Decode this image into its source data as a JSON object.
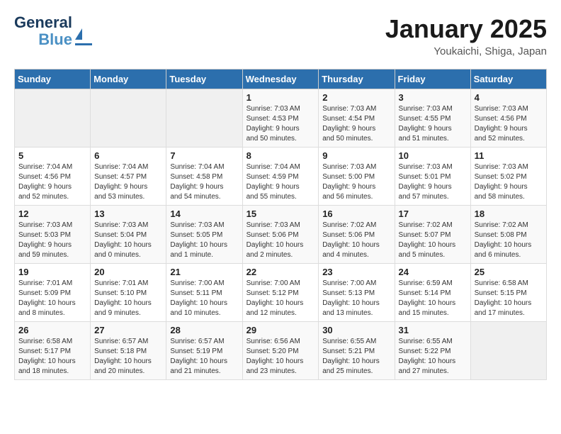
{
  "header": {
    "logo": {
      "part1": "General",
      "part2": "Blue"
    },
    "title": "January 2025",
    "location": "Youkaichi, Shiga, Japan"
  },
  "weekdays": [
    "Sunday",
    "Monday",
    "Tuesday",
    "Wednesday",
    "Thursday",
    "Friday",
    "Saturday"
  ],
  "weeks": [
    [
      {
        "day": "",
        "info": ""
      },
      {
        "day": "",
        "info": ""
      },
      {
        "day": "",
        "info": ""
      },
      {
        "day": "1",
        "info": "Sunrise: 7:03 AM\nSunset: 4:53 PM\nDaylight: 9 hours\nand 50 minutes."
      },
      {
        "day": "2",
        "info": "Sunrise: 7:03 AM\nSunset: 4:54 PM\nDaylight: 9 hours\nand 50 minutes."
      },
      {
        "day": "3",
        "info": "Sunrise: 7:03 AM\nSunset: 4:55 PM\nDaylight: 9 hours\nand 51 minutes."
      },
      {
        "day": "4",
        "info": "Sunrise: 7:03 AM\nSunset: 4:56 PM\nDaylight: 9 hours\nand 52 minutes."
      }
    ],
    [
      {
        "day": "5",
        "info": "Sunrise: 7:04 AM\nSunset: 4:56 PM\nDaylight: 9 hours\nand 52 minutes."
      },
      {
        "day": "6",
        "info": "Sunrise: 7:04 AM\nSunset: 4:57 PM\nDaylight: 9 hours\nand 53 minutes."
      },
      {
        "day": "7",
        "info": "Sunrise: 7:04 AM\nSunset: 4:58 PM\nDaylight: 9 hours\nand 54 minutes."
      },
      {
        "day": "8",
        "info": "Sunrise: 7:04 AM\nSunset: 4:59 PM\nDaylight: 9 hours\nand 55 minutes."
      },
      {
        "day": "9",
        "info": "Sunrise: 7:03 AM\nSunset: 5:00 PM\nDaylight: 9 hours\nand 56 minutes."
      },
      {
        "day": "10",
        "info": "Sunrise: 7:03 AM\nSunset: 5:01 PM\nDaylight: 9 hours\nand 57 minutes."
      },
      {
        "day": "11",
        "info": "Sunrise: 7:03 AM\nSunset: 5:02 PM\nDaylight: 9 hours\nand 58 minutes."
      }
    ],
    [
      {
        "day": "12",
        "info": "Sunrise: 7:03 AM\nSunset: 5:03 PM\nDaylight: 9 hours\nand 59 minutes."
      },
      {
        "day": "13",
        "info": "Sunrise: 7:03 AM\nSunset: 5:04 PM\nDaylight: 10 hours\nand 0 minutes."
      },
      {
        "day": "14",
        "info": "Sunrise: 7:03 AM\nSunset: 5:05 PM\nDaylight: 10 hours\nand 1 minute."
      },
      {
        "day": "15",
        "info": "Sunrise: 7:03 AM\nSunset: 5:06 PM\nDaylight: 10 hours\nand 2 minutes."
      },
      {
        "day": "16",
        "info": "Sunrise: 7:02 AM\nSunset: 5:06 PM\nDaylight: 10 hours\nand 4 minutes."
      },
      {
        "day": "17",
        "info": "Sunrise: 7:02 AM\nSunset: 5:07 PM\nDaylight: 10 hours\nand 5 minutes."
      },
      {
        "day": "18",
        "info": "Sunrise: 7:02 AM\nSunset: 5:08 PM\nDaylight: 10 hours\nand 6 minutes."
      }
    ],
    [
      {
        "day": "19",
        "info": "Sunrise: 7:01 AM\nSunset: 5:09 PM\nDaylight: 10 hours\nand 8 minutes."
      },
      {
        "day": "20",
        "info": "Sunrise: 7:01 AM\nSunset: 5:10 PM\nDaylight: 10 hours\nand 9 minutes."
      },
      {
        "day": "21",
        "info": "Sunrise: 7:00 AM\nSunset: 5:11 PM\nDaylight: 10 hours\nand 10 minutes."
      },
      {
        "day": "22",
        "info": "Sunrise: 7:00 AM\nSunset: 5:12 PM\nDaylight: 10 hours\nand 12 minutes."
      },
      {
        "day": "23",
        "info": "Sunrise: 7:00 AM\nSunset: 5:13 PM\nDaylight: 10 hours\nand 13 minutes."
      },
      {
        "day": "24",
        "info": "Sunrise: 6:59 AM\nSunset: 5:14 PM\nDaylight: 10 hours\nand 15 minutes."
      },
      {
        "day": "25",
        "info": "Sunrise: 6:58 AM\nSunset: 5:15 PM\nDaylight: 10 hours\nand 17 minutes."
      }
    ],
    [
      {
        "day": "26",
        "info": "Sunrise: 6:58 AM\nSunset: 5:17 PM\nDaylight: 10 hours\nand 18 minutes."
      },
      {
        "day": "27",
        "info": "Sunrise: 6:57 AM\nSunset: 5:18 PM\nDaylight: 10 hours\nand 20 minutes."
      },
      {
        "day": "28",
        "info": "Sunrise: 6:57 AM\nSunset: 5:19 PM\nDaylight: 10 hours\nand 21 minutes."
      },
      {
        "day": "29",
        "info": "Sunrise: 6:56 AM\nSunset: 5:20 PM\nDaylight: 10 hours\nand 23 minutes."
      },
      {
        "day": "30",
        "info": "Sunrise: 6:55 AM\nSunset: 5:21 PM\nDaylight: 10 hours\nand 25 minutes."
      },
      {
        "day": "31",
        "info": "Sunrise: 6:55 AM\nSunset: 5:22 PM\nDaylight: 10 hours\nand 27 minutes."
      },
      {
        "day": "",
        "info": ""
      }
    ]
  ]
}
